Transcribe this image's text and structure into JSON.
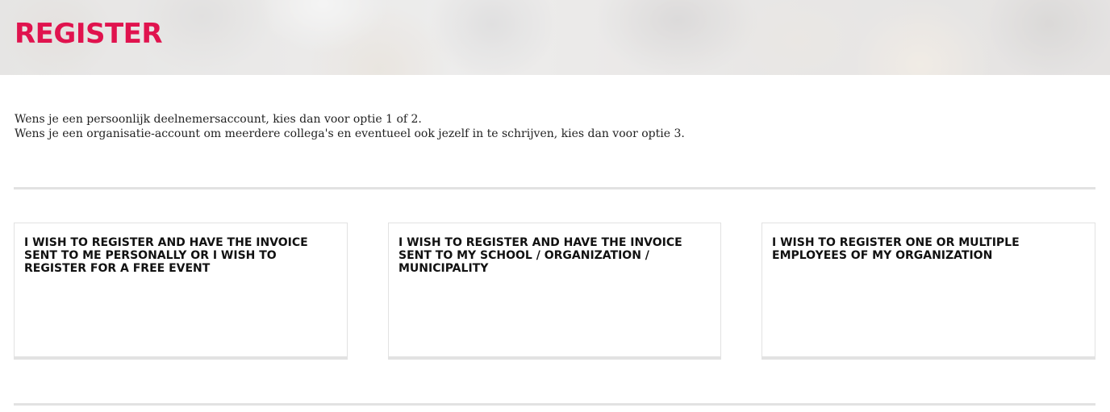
{
  "header": {
    "title": "REGISTER",
    "title_color": "#e0134e"
  },
  "intro": {
    "line1": "Wens je een persoonlijk deelnemersaccount, kies dan voor optie 1 of 2.",
    "line2": "Wens je een organisatie-account om meerdere collega's en eventueel ook jezelf in te schrijven, kies dan voor optie 3."
  },
  "options": [
    {
      "label": "I WISH TO REGISTER AND HAVE THE INVOICE SENT TO ME PERSONALLY OR I WISH TO REGISTER FOR A FREE EVENT"
    },
    {
      "label": "I WISH TO REGISTER AND HAVE THE INVOICE SENT TO MY SCHOOL / ORGANIZATION / MUNICIPALITY"
    },
    {
      "label": "I WISH TO REGISTER ONE OR MULTIPLE EMPLOYEES OF MY ORGANIZATION"
    }
  ]
}
